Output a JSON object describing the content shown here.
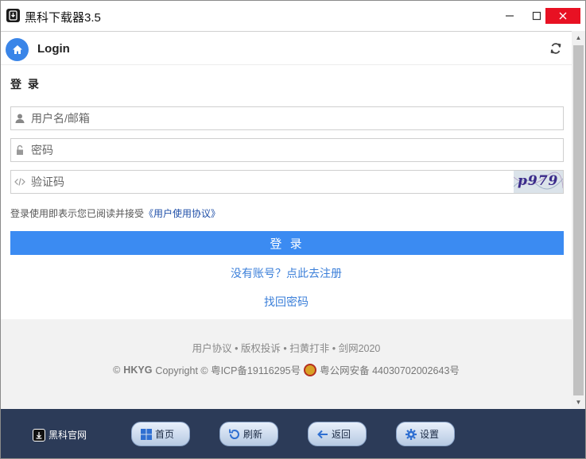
{
  "window": {
    "title": "黑科下载器3.5"
  },
  "header": {
    "title": "Login"
  },
  "form": {
    "section_title": "登 录",
    "username_placeholder": "用户名/邮箱",
    "password_placeholder": "密码",
    "captcha_placeholder": "验证码",
    "captcha_text": "p979",
    "agreement_prefix": "登录使用即表示您已阅读并接受",
    "agreement_link": "《用户使用协议》",
    "login_button": "登 录",
    "register_link": "没有账号？点此去注册",
    "find_password_link": "找回密码"
  },
  "footer": {
    "links": "用户协议 • 版权投诉 • 扫黄打非 • 剑网2020",
    "copyright_prefix": "©",
    "brand": "HKYG",
    "copyright_text": "Copyright © 粤ICP备19116295号",
    "police_text": "粤公网安备 44030702002643号"
  },
  "toolbar": {
    "official_site": "黑科官网",
    "home": "首页",
    "refresh": "刷新",
    "back": "返回",
    "settings": "设置"
  },
  "colors": {
    "accent": "#3b8bf2",
    "link": "#3b7fd9",
    "toolbar_bg": "#2c3b58",
    "close_red": "#e81123"
  },
  "icons": [
    "app-icon",
    "home-icon",
    "refresh-icon",
    "user-icon",
    "lock-icon",
    "code-icon",
    "police-badge-icon",
    "download-icon",
    "windows-icon",
    "reload-icon",
    "back-arrow-icon",
    "gear-icon"
  ]
}
